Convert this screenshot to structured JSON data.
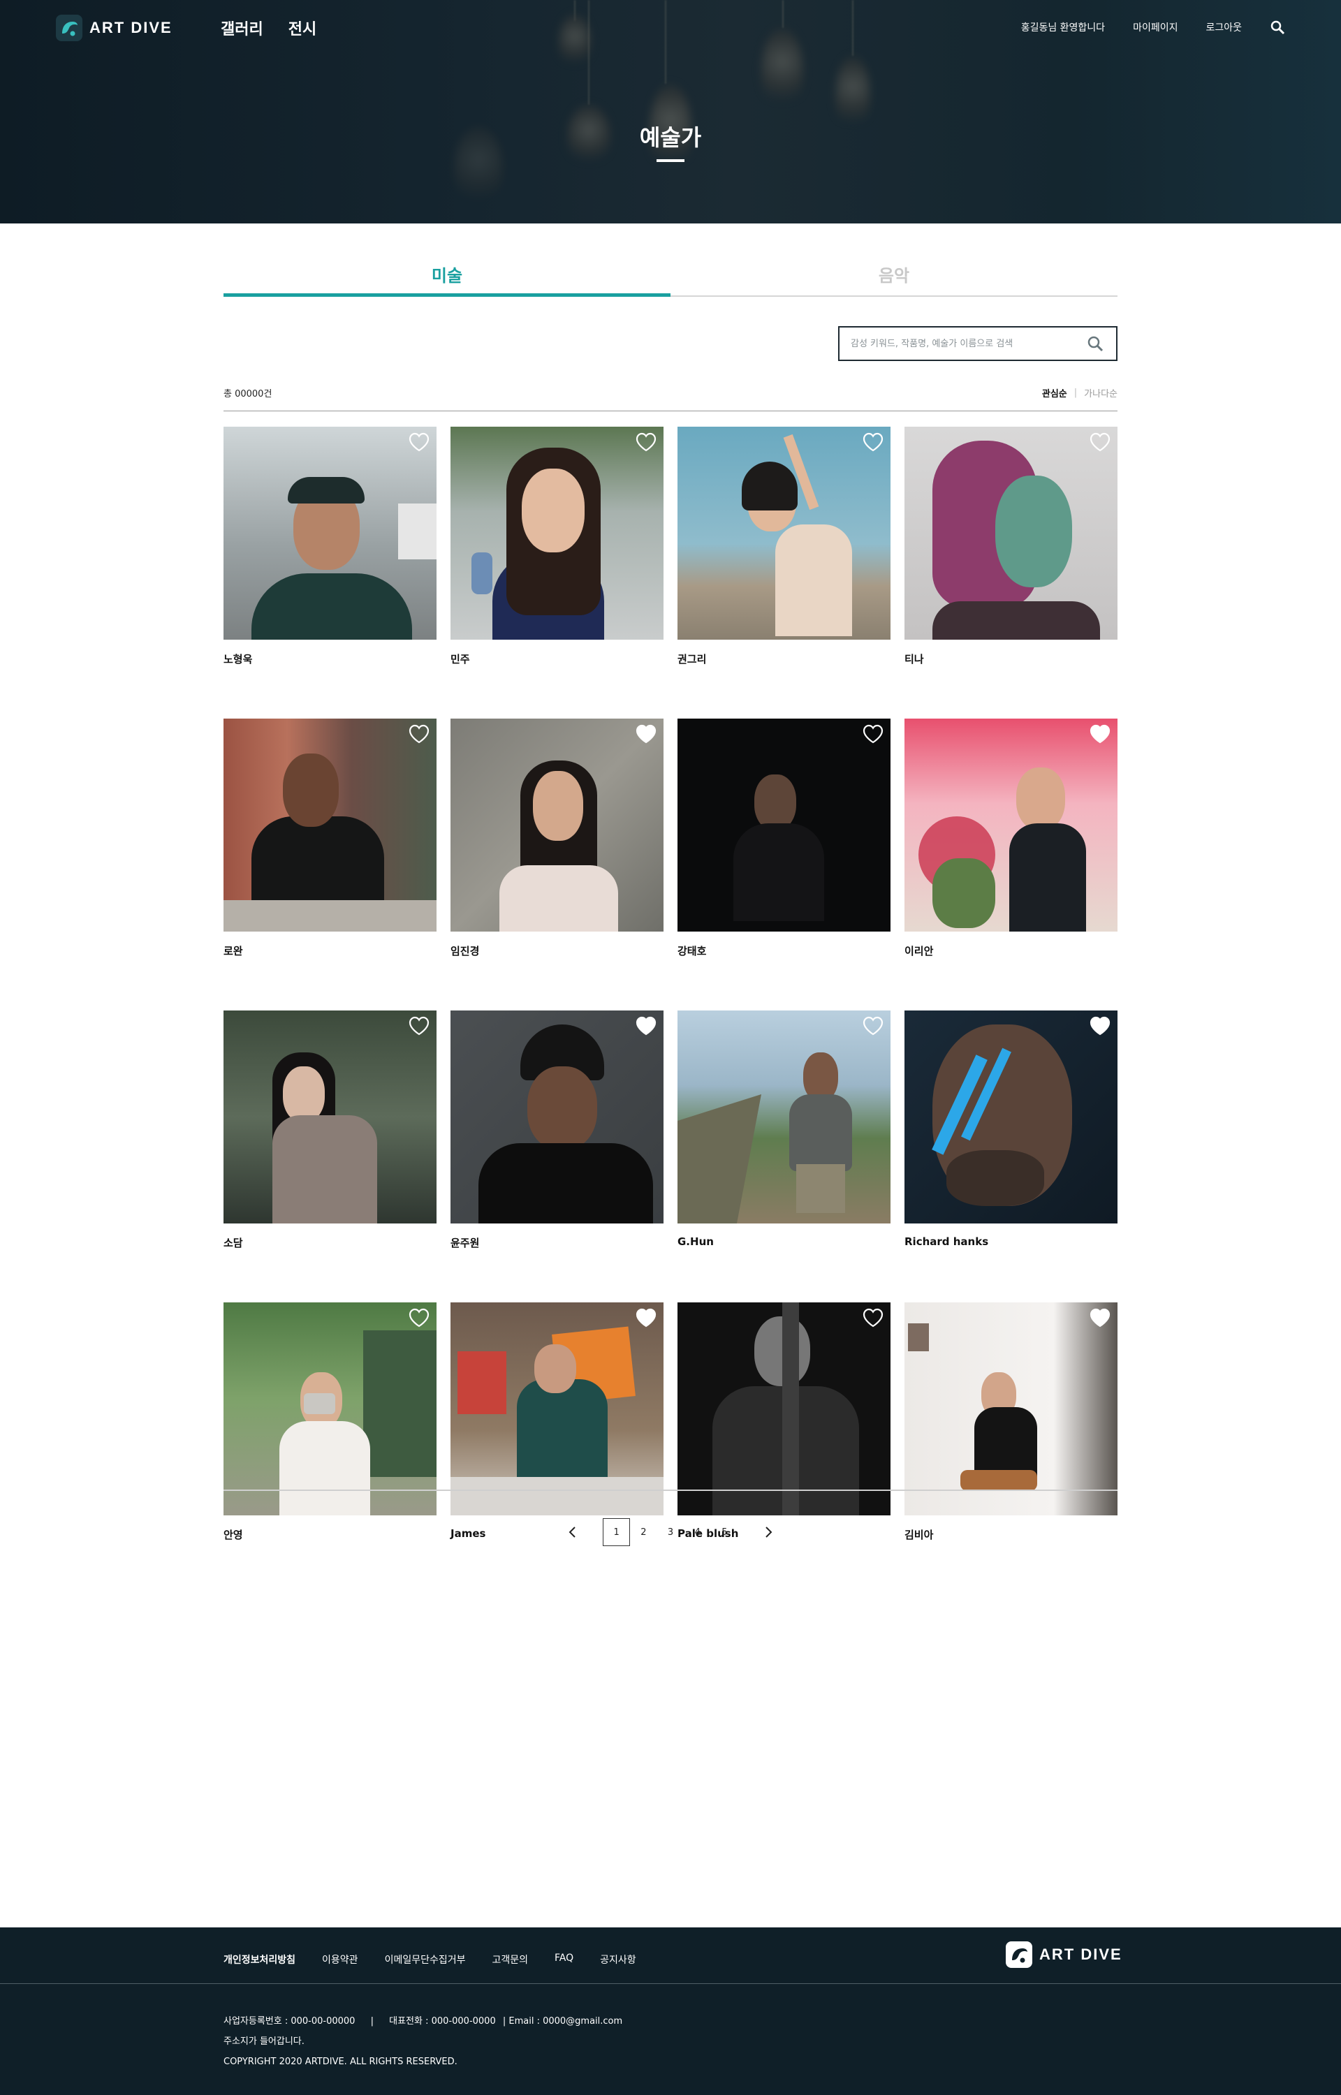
{
  "header": {
    "logo_text": "ART DIVE",
    "nav": [
      "갤러리",
      "전시"
    ],
    "welcome": "홍길동님 환영합니다",
    "mypage": "마이페이지",
    "logout": "로그아웃",
    "search_icon": "search-icon"
  },
  "hero": {
    "title": "예술가"
  },
  "tabs": [
    {
      "label": "미술",
      "active": true
    },
    {
      "label": "음악",
      "active": false
    }
  ],
  "search": {
    "placeholder": "감성 키워드, 작품명, 예술가 이름으로 검색"
  },
  "list": {
    "total": "총 00000건",
    "sort_active": "관심순",
    "sort_separator": "|",
    "sort_inactive": "가나다순"
  },
  "artists": [
    {
      "name": "노형욱",
      "liked": false
    },
    {
      "name": "민주",
      "liked": false
    },
    {
      "name": "권그리",
      "liked": false
    },
    {
      "name": "티나",
      "liked": false
    },
    {
      "name": "로완",
      "liked": false
    },
    {
      "name": "임진경",
      "liked": true
    },
    {
      "name": "강태호",
      "liked": false
    },
    {
      "name": "이리안",
      "liked": true
    },
    {
      "name": "소담",
      "liked": false
    },
    {
      "name": "윤주원",
      "liked": true
    },
    {
      "name": "G.Hun",
      "liked": false
    },
    {
      "name": "Richard hanks",
      "liked": true
    },
    {
      "name": "안영",
      "liked": false
    },
    {
      "name": "James",
      "liked": true
    },
    {
      "name": "Pale blush",
      "liked": false
    },
    {
      "name": "김비아",
      "liked": true
    }
  ],
  "pagination": {
    "pages": [
      "1",
      "2",
      "3",
      "4",
      "5"
    ],
    "current": "1"
  },
  "footer": {
    "links": [
      "개인정보처리방침",
      "이용약관",
      "이메일무단수집거부",
      "고객문의",
      "FAQ",
      "공지사항"
    ],
    "logo_text": "ART DIVE",
    "biz_no": "사업자등록번호 : 000-00-00000",
    "sep": "|",
    "phone": "대표전화 : 000-000-0000",
    "email": "| Email : 0000@gmail.com",
    "address": "주소지가 들어갑니다.",
    "copyright": "COPYRIGHT 2020 ARTDIVE. ALL RIGHTS RESERVED."
  },
  "colors": {
    "accent": "#1aa0a0",
    "header_bg": "#14242d",
    "footer_bg": "#0f1f28"
  }
}
